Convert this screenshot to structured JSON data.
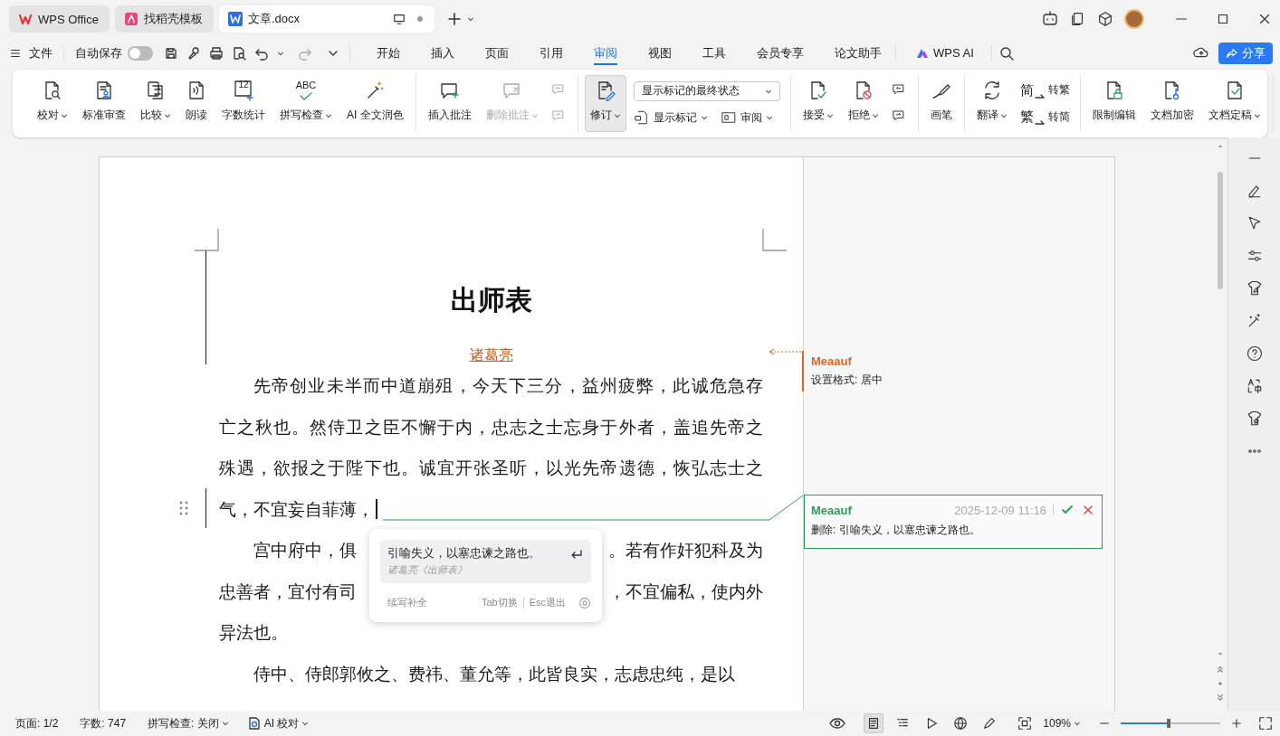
{
  "tabs": [
    {
      "label": "WPS Office",
      "selected": false
    },
    {
      "label": "找稻壳模板",
      "selected": false
    },
    {
      "label": "文章.docx",
      "selected": true
    }
  ],
  "quick_bar": {
    "file_menu": "文件",
    "autosave": {
      "label": "自动保存",
      "on": false
    }
  },
  "menu": [
    {
      "label": "开始",
      "selected": false
    },
    {
      "label": "插入",
      "selected": false
    },
    {
      "label": "页面",
      "selected": false
    },
    {
      "label": "引用",
      "selected": false
    },
    {
      "label": "审阅",
      "selected": true
    },
    {
      "label": "视图",
      "selected": false
    },
    {
      "label": "工具",
      "selected": false
    },
    {
      "label": "会员专享",
      "selected": false
    },
    {
      "label": "论文助手",
      "selected": false
    }
  ],
  "ai_menu": {
    "label": "WPS AI",
    "selected": false
  },
  "share_button": "分享",
  "ribbon": [
    {
      "items": [
        {
          "kind": "large",
          "label": "校对",
          "dropdown": true,
          "disabled": false
        },
        {
          "kind": "large",
          "label": "标准审查",
          "dropdown": false,
          "disabled": false
        },
        {
          "kind": "large",
          "label": "比较",
          "dropdown": true,
          "disabled": false
        },
        {
          "kind": "large",
          "label": "朗读",
          "dropdown": false,
          "disabled": false
        },
        {
          "kind": "large",
          "label": "字数统计",
          "dropdown": false,
          "disabled": false,
          "icon_text": "12"
        },
        {
          "kind": "large",
          "label": "拼写检查",
          "dropdown": true,
          "disabled": false,
          "icon_text": "ABC"
        },
        {
          "kind": "large",
          "label": "AI 全文润色",
          "dropdown": false,
          "disabled": false
        }
      ]
    },
    {
      "items": [
        {
          "kind": "large",
          "label": "插入批注",
          "dropdown": false,
          "disabled": false
        },
        {
          "kind": "large",
          "label": "删除批注",
          "dropdown": true,
          "disabled": true
        },
        {
          "kind": "stack",
          "rows": [
            [
              {
                "kind": "icon",
                "disabled": true
              }
            ],
            [
              {
                "kind": "icon",
                "disabled": true
              }
            ]
          ]
        }
      ]
    },
    {
      "items": [
        {
          "kind": "toggle",
          "label": "修订",
          "dropdown": true,
          "on": true
        },
        {
          "kind": "stack",
          "rows": [
            [
              {
                "kind": "select",
                "value": "显示标记的最终状态"
              }
            ],
            [
              {
                "kind": "inline",
                "label": "显示标记",
                "dropdown": true,
                "disabled": false
              },
              {
                "kind": "inline",
                "label": "审阅",
                "dropdown": true,
                "disabled": false
              }
            ]
          ]
        }
      ]
    },
    {
      "items": [
        {
          "kind": "large",
          "label": "接受",
          "dropdown": true,
          "disabled": false
        },
        {
          "kind": "large",
          "label": "拒绝",
          "dropdown": true,
          "disabled": false
        },
        {
          "kind": "stack",
          "rows": [
            [
              {
                "kind": "icon",
                "disabled": false
              }
            ],
            [
              {
                "kind": "icon",
                "disabled": false
              }
            ]
          ]
        }
      ]
    },
    {
      "items": [
        {
          "kind": "large",
          "label": "画笔",
          "dropdown": false,
          "disabled": false
        }
      ]
    },
    {
      "items": [
        {
          "kind": "large",
          "label": "翻译",
          "dropdown": true,
          "disabled": false
        },
        {
          "kind": "stack",
          "rows": [
            [
              {
                "kind": "inline",
                "label": "转繁",
                "dropdown": false,
                "disabled": false,
                "icon_text": "简"
              }
            ],
            [
              {
                "kind": "inline",
                "label": "转简",
                "dropdown": false,
                "disabled": false,
                "icon_text": "繁"
              }
            ]
          ]
        }
      ]
    },
    {
      "items": [
        {
          "kind": "large",
          "label": "限制编辑",
          "dropdown": false,
          "disabled": false
        },
        {
          "kind": "large",
          "label": "文档加密",
          "dropdown": false,
          "disabled": false
        },
        {
          "kind": "large",
          "label": "文档定稿",
          "dropdown": true,
          "disabled": false
        }
      ]
    }
  ],
  "document": {
    "title": "出师表",
    "author": "诸葛亮",
    "paragraphs": [
      {
        "lines": [
          [
            "先帝创业未半而中道崩殂，今天下三分，益州疲弊，此诚危急存"
          ],
          [
            "亡之秋也。然侍卫之臣不懈于内，忠志之士忘身于外者，盖追先帝之"
          ],
          [
            "殊遇，欲报之于陛下也。诚宜开张圣听，以光先帝遗德，恢弘志士之"
          ],
          [
            "气，不宜妄自菲薄，"
          ]
        ]
      },
      {
        "lines": [
          [
            "宫中府中，俱",
            "。若有作奸犯科及为"
          ],
          [
            "忠善者，宜付有司",
            "，不宜偏私，使内外"
          ],
          [
            "异法也。"
          ]
        ]
      },
      {
        "lines": [
          [
            "侍中、侍郎郭攸之、费祎、董允等，此皆良实，志虑忠纯，是以"
          ]
        ]
      }
    ]
  },
  "suggestion": {
    "text": "引喻失义，以塞忠谏之路也。",
    "source": "诸葛亮《出师表》",
    "label": "续写补全",
    "hints": [
      "Tab切换",
      "Esc退出"
    ]
  },
  "comments": [
    {
      "kind": "note",
      "author": "Meaauf",
      "text": "设置格式: 居中",
      "color": "#e0672b"
    },
    {
      "kind": "change",
      "author": "Meaauf",
      "time": "2025-12-09 11:16",
      "text": "删除: 引喻失义，以塞忠谏之路也。",
      "color": "#2e9a5c"
    }
  ],
  "status_bar": {
    "page": "页面: 1/2",
    "words": "字数: 747",
    "spell_check": "拼写检查: 关闭",
    "ai_check": "AI 校对",
    "zoom": "109%",
    "zoom_slider": {
      "level": 0.48
    },
    "view_modes": [
      {
        "selected": true
      },
      {
        "selected": false
      },
      {
        "selected": false
      },
      {
        "selected": false
      },
      {
        "selected": false
      }
    ]
  }
}
